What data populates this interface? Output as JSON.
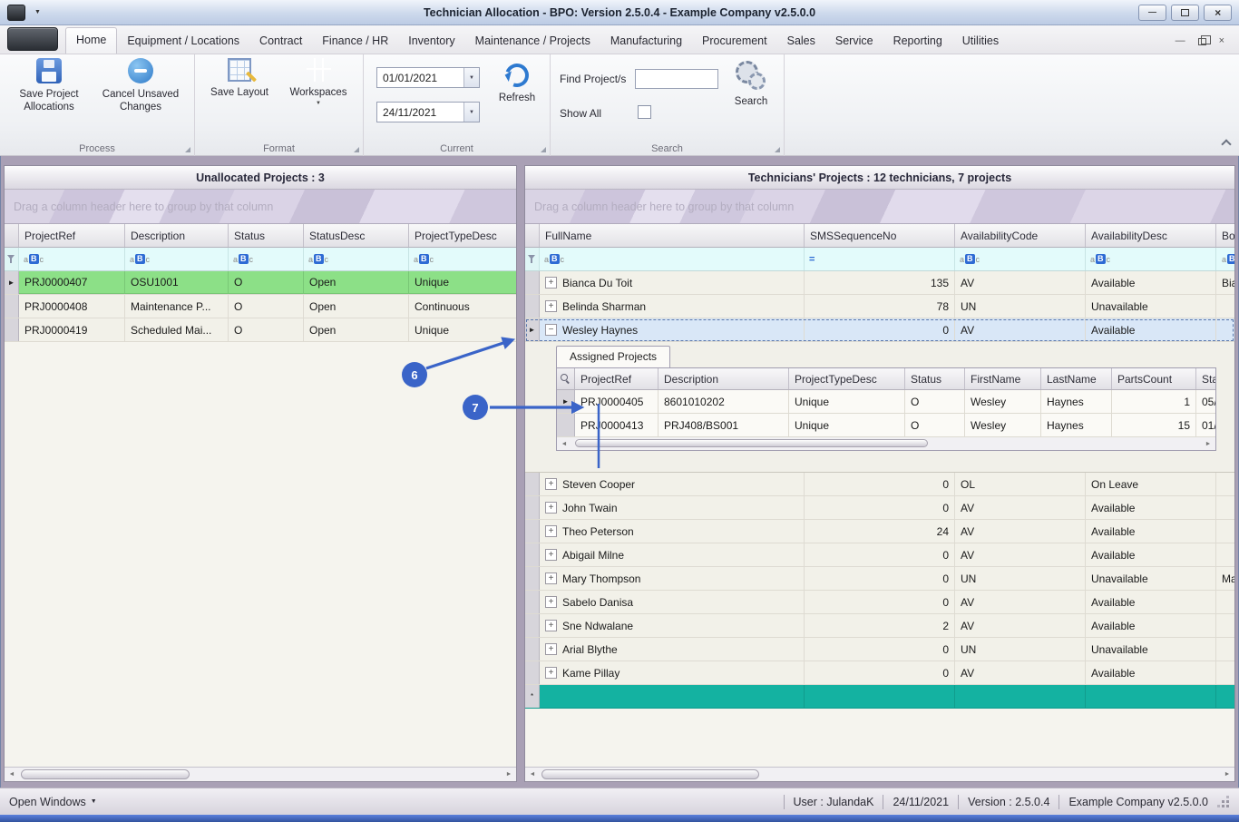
{
  "titlebar": {
    "title": "Technician Allocation - BPO: Version 2.5.0.4 - Example Company v2.5.0.0"
  },
  "ribbon": {
    "tabs": [
      "Home",
      "Equipment / Locations",
      "Contract",
      "Finance / HR",
      "Inventory",
      "Maintenance / Projects",
      "Manufacturing",
      "Procurement",
      "Sales",
      "Service",
      "Reporting",
      "Utilities"
    ],
    "process": {
      "caption": "Process",
      "save_allocations": "Save Project Allocations",
      "cancel_changes": "Cancel Unsaved Changes"
    },
    "format": {
      "caption": "Format",
      "save_layout": "Save Layout",
      "workspaces": "Workspaces"
    },
    "current": {
      "caption": "Current",
      "date_from": "01/01/2021",
      "date_to": "24/11/2021",
      "refresh": "Refresh"
    },
    "search": {
      "caption": "Search",
      "find_label": "Find Project/s",
      "find_value": "",
      "show_all": "Show All",
      "search_label": "Search"
    }
  },
  "left_panel": {
    "title": "Unallocated Projects : 3",
    "group_hint": "Drag a column header here to group by that column",
    "columns": [
      "ProjectRef",
      "Description",
      "Status",
      "StatusDesc",
      "ProjectTypeDesc"
    ],
    "rows": [
      [
        "PRJ0000407",
        "OSU1001",
        "O",
        "Open",
        "Unique"
      ],
      [
        "PRJ0000408",
        "Maintenance P...",
        "O",
        "Open",
        "Continuous"
      ],
      [
        "PRJ0000419",
        "Scheduled Mai...",
        "O",
        "Open",
        "Unique"
      ]
    ]
  },
  "right_panel": {
    "title": "Technicians' Projects : 12 technicians, 7 projects",
    "group_hint": "Drag a column header here to group by that column",
    "columns": [
      "FullName",
      "SMSSequenceNo",
      "AvailabilityCode",
      "AvailabilityDesc",
      "Boo"
    ],
    "rows": [
      {
        "name": "Bianca Du Toit",
        "sms": "135",
        "code": "AV",
        "desc": "Available",
        "extra": "Bia"
      },
      {
        "name": "Belinda Sharman",
        "sms": "78",
        "code": "UN",
        "desc": "Unavailable",
        "extra": ""
      },
      {
        "name": "Wesley Haynes",
        "sms": "0",
        "code": "AV",
        "desc": "Available",
        "extra": ""
      },
      {
        "name": "Steven Cooper",
        "sms": "0",
        "code": "OL",
        "desc": "On Leave",
        "extra": ""
      },
      {
        "name": "John Twain",
        "sms": "0",
        "code": "AV",
        "desc": "Available",
        "extra": ""
      },
      {
        "name": "Theo Peterson",
        "sms": "24",
        "code": "AV",
        "desc": "Available",
        "extra": ""
      },
      {
        "name": "Abigail Milne",
        "sms": "0",
        "code": "AV",
        "desc": "Available",
        "extra": ""
      },
      {
        "name": "Mary Thompson",
        "sms": "0",
        "code": "UN",
        "desc": "Unavailable",
        "extra": "Ma"
      },
      {
        "name": "Sabelo Danisa",
        "sms": "0",
        "code": "AV",
        "desc": "Available",
        "extra": ""
      },
      {
        "name": "Sne Ndwalane",
        "sms": "2",
        "code": "AV",
        "desc": "Available",
        "extra": ""
      },
      {
        "name": "Arial Blythe",
        "sms": "0",
        "code": "UN",
        "desc": "Unavailable",
        "extra": ""
      },
      {
        "name": "Kame Pillay",
        "sms": "0",
        "code": "AV",
        "desc": "Available",
        "extra": ""
      }
    ],
    "detail": {
      "tab": "Assigned Projects",
      "columns": [
        "ProjectRef",
        "Description",
        "ProjectTypeDesc",
        "Status",
        "FirstName",
        "LastName",
        "PartsCount",
        "Sta"
      ],
      "rows": [
        [
          "PRJ0000405",
          "8601010202",
          "Unique",
          "O",
          "Wesley",
          "Haynes",
          "1",
          "05/"
        ],
        [
          "PRJ0000413",
          "PRJ408/BS001",
          "Unique",
          "O",
          "Wesley",
          "Haynes",
          "15",
          "01/"
        ]
      ]
    }
  },
  "annotations": {
    "badge6": "6",
    "badge7": "7",
    "color": "#3a64c8"
  },
  "statusbar": {
    "open_windows": "Open Windows",
    "user": "User : JulandaK",
    "date": "24/11/2021",
    "version": "Version : 2.5.0.4",
    "company": "Example Company v2.5.0.0"
  },
  "icons": {
    "caret_down": "▼",
    "row_arrow": "►",
    "plus": "+",
    "minus": "−",
    "asterisk": "*",
    "scroll_left": "◄",
    "scroll_right": "►",
    "minimize": "—",
    "close": "×",
    "equals_filter": "=",
    "abc_a": "a",
    "abc_b": "B",
    "abc_c": "c"
  },
  "colors": {
    "selected_row": "#8ce087",
    "expanded_row": "#d9e7f7",
    "new_row": "#14b2a1",
    "filter_row": "#e3fbfb"
  }
}
